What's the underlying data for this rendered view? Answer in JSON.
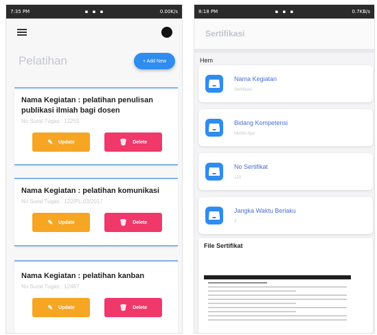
{
  "left": {
    "status_time": "7:35 PM",
    "status_right": "0.00K/s",
    "page_title": "Pelatihan",
    "add_button": "+ Add New",
    "cards": [
      {
        "title": "Nama Kegiatan : pelatihan penulisan publikasi ilmiah bagi dosen",
        "sub": "No Surat Tugas : 12255"
      },
      {
        "title": "Nama Kegiatan : pelatihan komunikasi",
        "sub": "No Surat Tugas : 122/PL.03/2017"
      },
      {
        "title": "Nama Kegiatan : pelatihan kanban",
        "sub": "No Surat Tugas : 12467"
      }
    ],
    "update_label": "Update",
    "delete_label": "Delete",
    "colors": {
      "update": "#f6a623",
      "delete": "#f0386b",
      "accent": "#2f8cf0"
    }
  },
  "right": {
    "status_time": "8:18 PM",
    "status_right": "0.7KB/s",
    "header_title": "Sertifikasi",
    "section_label": "Hem",
    "items": [
      {
        "label": "Nama Kegiatan",
        "value": "Sertifikasi"
      },
      {
        "label": "Bidang Kompetensi",
        "value": "Mobile App"
      },
      {
        "label": "No Sertifikat",
        "value": "123"
      },
      {
        "label": "Jangka Waktu Berlaku",
        "value": "3"
      }
    ],
    "file_title": "File Sertifikat",
    "icons": {
      "item": "certificate-icon"
    }
  }
}
